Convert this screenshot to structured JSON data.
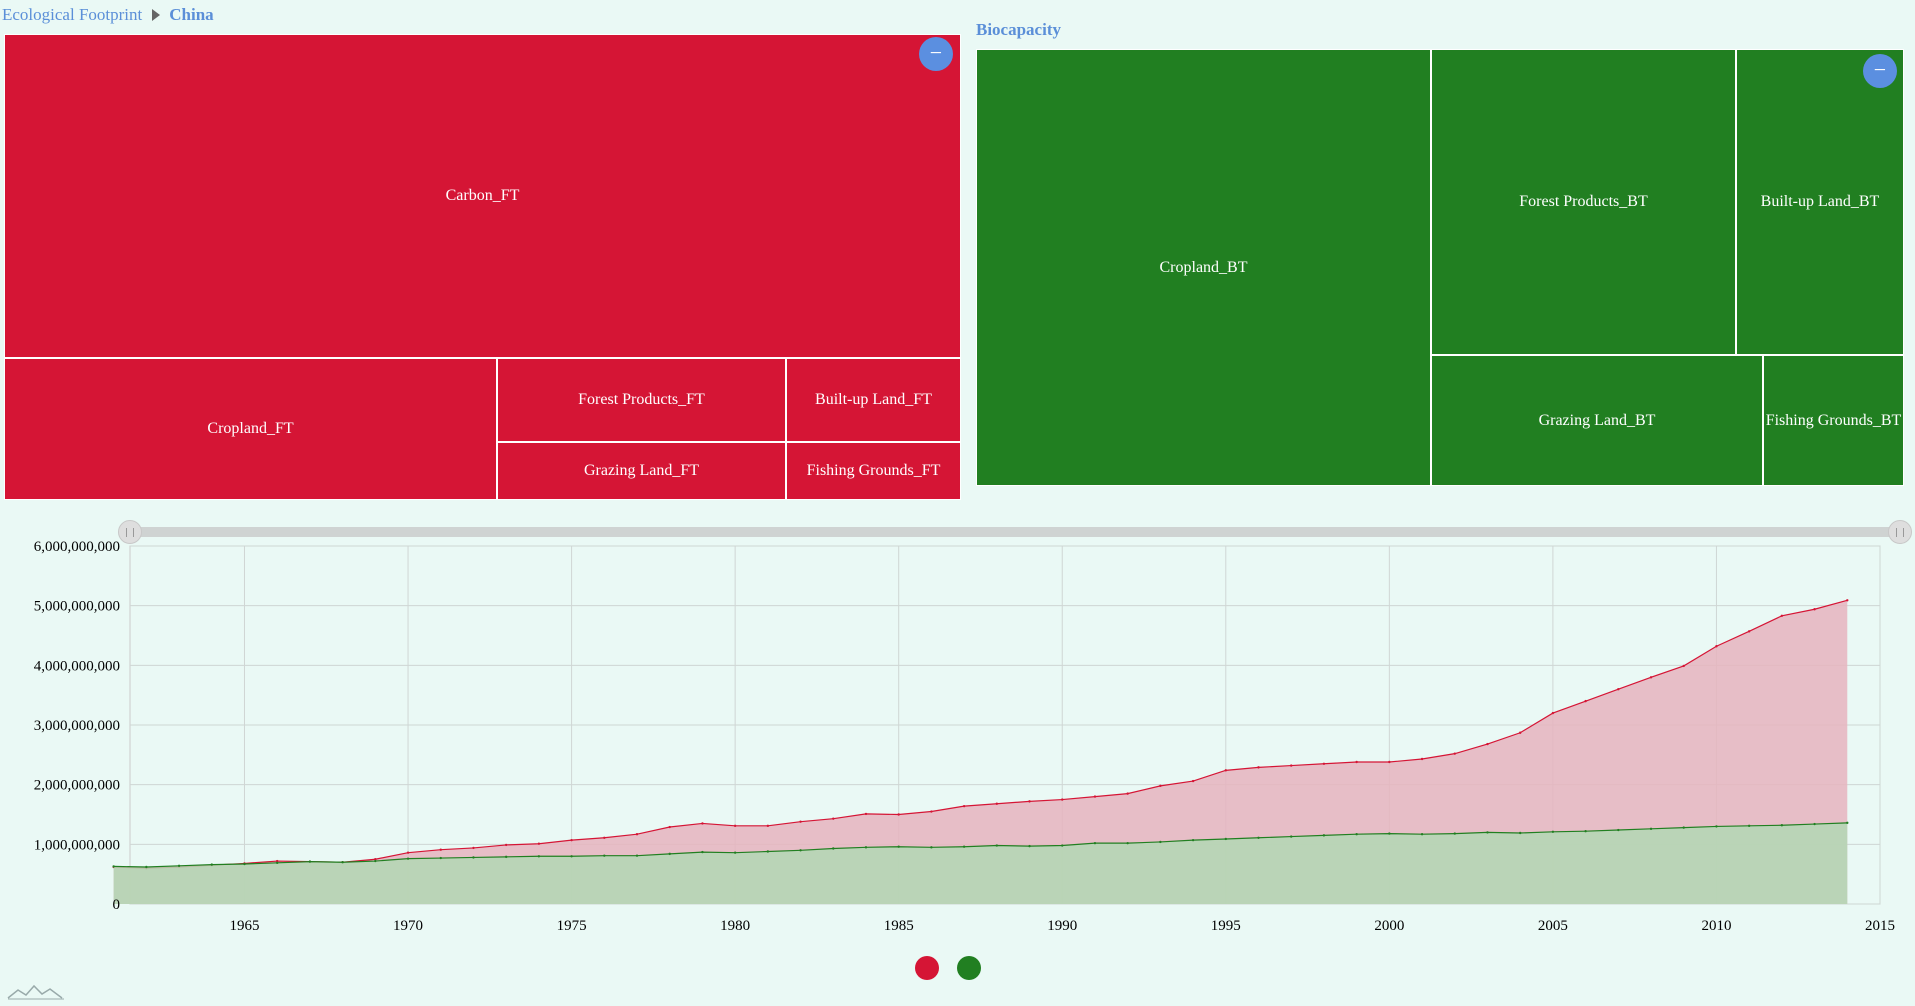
{
  "breadcrumb": {
    "root": "Ecological Footprint",
    "current": "China"
  },
  "biocapacity_title": "Biocapacity",
  "footprint_cells": {
    "carbon": "Carbon_FT",
    "cropland": "Cropland_FT",
    "forest": "Forest Products_FT",
    "builtup": "Built-up Land_FT",
    "grazing": "Grazing Land_FT",
    "fishing": "Fishing Grounds_FT"
  },
  "bio_cells": {
    "cropland": "Cropland_BT",
    "forest": "Forest Products_BT",
    "builtup": "Built-up Land_BT",
    "grazing": "Grazing Land_BT",
    "fishing": "Fishing Grounds_BT"
  },
  "icons": {
    "zoom_out": "minus-circle-icon",
    "logo": "sparkline-logo-icon"
  },
  "colors": {
    "footprint": "#d51535",
    "biocapacity": "#217f21",
    "footprint_area": "#e6b4be",
    "bio_area": "#b2d8b4",
    "button": "#5b8fe0"
  },
  "chart_data": {
    "type": "area",
    "title": "",
    "xlabel": "",
    "ylabel": "",
    "xlim": [
      1961.5,
      2015
    ],
    "ylim": [
      0,
      6000000000
    ],
    "xticks": [
      "1965",
      "1970",
      "1975",
      "1980",
      "1985",
      "1990",
      "1995",
      "2000",
      "2005",
      "2010",
      "2015"
    ],
    "yticks": [
      "0",
      "1,000,000,000",
      "2,000,000,000",
      "3,000,000,000",
      "4,000,000,000",
      "5,000,000,000",
      "6,000,000,000"
    ],
    "grid": true,
    "x": [
      1961,
      1962,
      1963,
      1964,
      1965,
      1966,
      1967,
      1968,
      1969,
      1970,
      1971,
      1972,
      1973,
      1974,
      1975,
      1976,
      1977,
      1978,
      1979,
      1980,
      1981,
      1982,
      1983,
      1984,
      1985,
      1986,
      1987,
      1988,
      1989,
      1990,
      1991,
      1992,
      1993,
      1994,
      1995,
      1996,
      1997,
      1998,
      1999,
      2000,
      2001,
      2002,
      2003,
      2004,
      2005,
      2006,
      2007,
      2008,
      2009,
      2010,
      2011,
      2012,
      2013,
      2014
    ],
    "series": [
      {
        "color": "#d51535",
        "values": [
          620000000,
          600000000,
          620000000,
          650000000,
          680000000,
          720000000,
          710000000,
          700000000,
          750000000,
          860000000,
          910000000,
          940000000,
          990000000,
          1010000000,
          1070000000,
          1110000000,
          1170000000,
          1290000000,
          1350000000,
          1310000000,
          1310000000,
          1380000000,
          1430000000,
          1510000000,
          1500000000,
          1550000000,
          1640000000,
          1680000000,
          1720000000,
          1750000000,
          1800000000,
          1850000000,
          1980000000,
          2060000000,
          2240000000,
          2290000000,
          2320000000,
          2350000000,
          2380000000,
          2380000000,
          2430000000,
          2520000000,
          2680000000,
          2870000000,
          3200000000,
          3400000000,
          3600000000,
          3800000000,
          3990000000,
          4320000000,
          4570000000,
          4830000000,
          4940000000,
          5090000000
        ]
      },
      {
        "color": "#217f21",
        "values": [
          630000000,
          620000000,
          640000000,
          660000000,
          670000000,
          690000000,
          710000000,
          700000000,
          720000000,
          760000000,
          770000000,
          780000000,
          790000000,
          800000000,
          800000000,
          810000000,
          810000000,
          840000000,
          870000000,
          860000000,
          880000000,
          900000000,
          930000000,
          950000000,
          960000000,
          950000000,
          960000000,
          980000000,
          970000000,
          980000000,
          1020000000,
          1020000000,
          1040000000,
          1070000000,
          1090000000,
          1110000000,
          1130000000,
          1150000000,
          1170000000,
          1180000000,
          1170000000,
          1180000000,
          1200000000,
          1190000000,
          1210000000,
          1220000000,
          1240000000,
          1260000000,
          1280000000,
          1300000000,
          1310000000,
          1320000000,
          1340000000,
          1360000000
        ]
      }
    ],
    "legend": "bottom-center"
  }
}
